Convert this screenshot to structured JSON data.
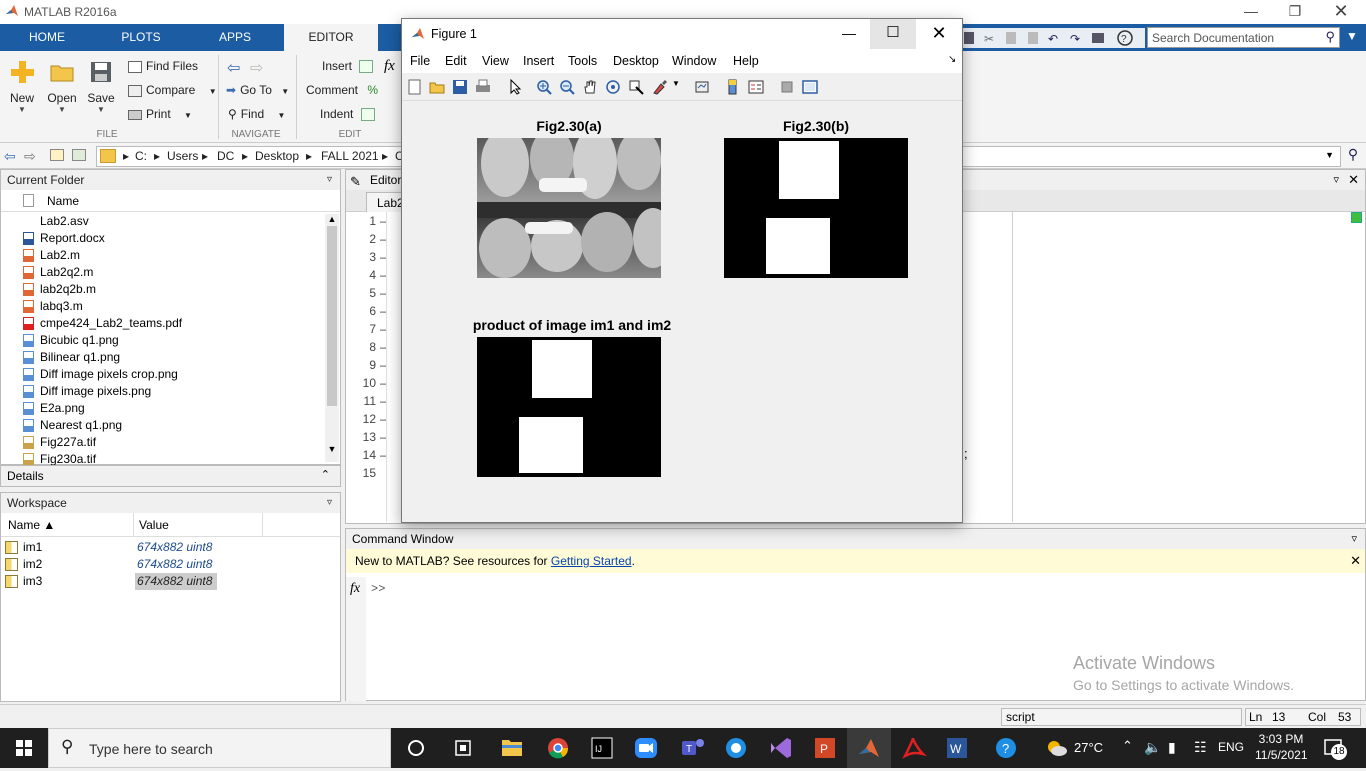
{
  "window": {
    "title": "MATLAB R2016a"
  },
  "ribbon": {
    "tabs": [
      "HOME",
      "PLOTS",
      "APPS",
      "EDITOR"
    ],
    "new_label": "New",
    "open_label": "Open",
    "save_label": "Save",
    "find_files": "Find Files",
    "compare": "Compare",
    "print": "Print",
    "goto": "Go To",
    "find": "Find",
    "insert": "Insert",
    "comment": "Comment",
    "indent": "Indent",
    "section_file": "FILE",
    "section_navigate": "NAVIGATE",
    "section_edit": "EDIT",
    "search_placeholder": "Search Documentation"
  },
  "address": {
    "crumbs": [
      "C:",
      "Users",
      "DC",
      "Desktop",
      "FALL 2021",
      "C"
    ]
  },
  "current_folder": {
    "title": "Current Folder",
    "col_name": "Name",
    "files": [
      {
        "name": "Lab2.asv",
        "type": "asv"
      },
      {
        "name": "Report.docx",
        "type": "docx"
      },
      {
        "name": "Lab2.m",
        "type": "m"
      },
      {
        "name": "Lab2q2.m",
        "type": "m"
      },
      {
        "name": "lab2q2b.m",
        "type": "m"
      },
      {
        "name": "labq3.m",
        "type": "m"
      },
      {
        "name": "cmpe424_Lab2_teams.pdf",
        "type": "pdf"
      },
      {
        "name": "Bicubic q1.png",
        "type": "png"
      },
      {
        "name": "Bilinear q1.png",
        "type": "png"
      },
      {
        "name": "Diff image pixels crop.png",
        "type": "png"
      },
      {
        "name": "Diff image pixels.png",
        "type": "png"
      },
      {
        "name": "E2a.png",
        "type": "png"
      },
      {
        "name": "Nearest q1.png",
        "type": "png"
      },
      {
        "name": "Fig227a.tif",
        "type": "tif"
      },
      {
        "name": "Fig230a.tif",
        "type": "tif"
      }
    ]
  },
  "details": {
    "title": "Details"
  },
  "workspace": {
    "title": "Workspace",
    "col_name": "Name ▲",
    "col_value": "Value",
    "vars": [
      {
        "name": "im1",
        "value": "674x882 uint8"
      },
      {
        "name": "im2",
        "value": "674x882 uint8"
      },
      {
        "name": "im3",
        "value": "674x882 uint8"
      }
    ]
  },
  "editor": {
    "title": "Editor",
    "tab": "Lab2",
    "line_numbers": [
      "1",
      "2",
      "3",
      "4",
      "5",
      "6",
      "7",
      "8",
      "9",
      "10",
      "11",
      "12",
      "13",
      "14",
      "15"
    ],
    "semicolon": ";"
  },
  "command_window": {
    "title": "Command Window",
    "banner_text": "New to MATLAB? See resources for ",
    "banner_link": "Getting Started",
    "banner_end": ".",
    "prompt": ">>",
    "fx": "fx"
  },
  "watermark": {
    "line1": "Activate Windows",
    "line2": "Go to Settings to activate Windows."
  },
  "status": {
    "mode": "script",
    "ln_label": "Ln",
    "ln": "13",
    "col_label": "Col",
    "col": "53"
  },
  "figure": {
    "title": "Figure 1",
    "menus": [
      "File",
      "Edit",
      "View",
      "Insert",
      "Tools",
      "Desktop",
      "Window",
      "Help"
    ],
    "axes": [
      {
        "title": "Fig2.30(a)"
      },
      {
        "title": "Fig2.30(b)"
      },
      {
        "title": "product of image im1 and im2"
      }
    ]
  },
  "taskbar": {
    "search_placeholder": "Type here to search",
    "weather": "27°C",
    "lang": "ENG",
    "time": "3:03 PM",
    "date": "11/5/2021",
    "notif": "18"
  }
}
